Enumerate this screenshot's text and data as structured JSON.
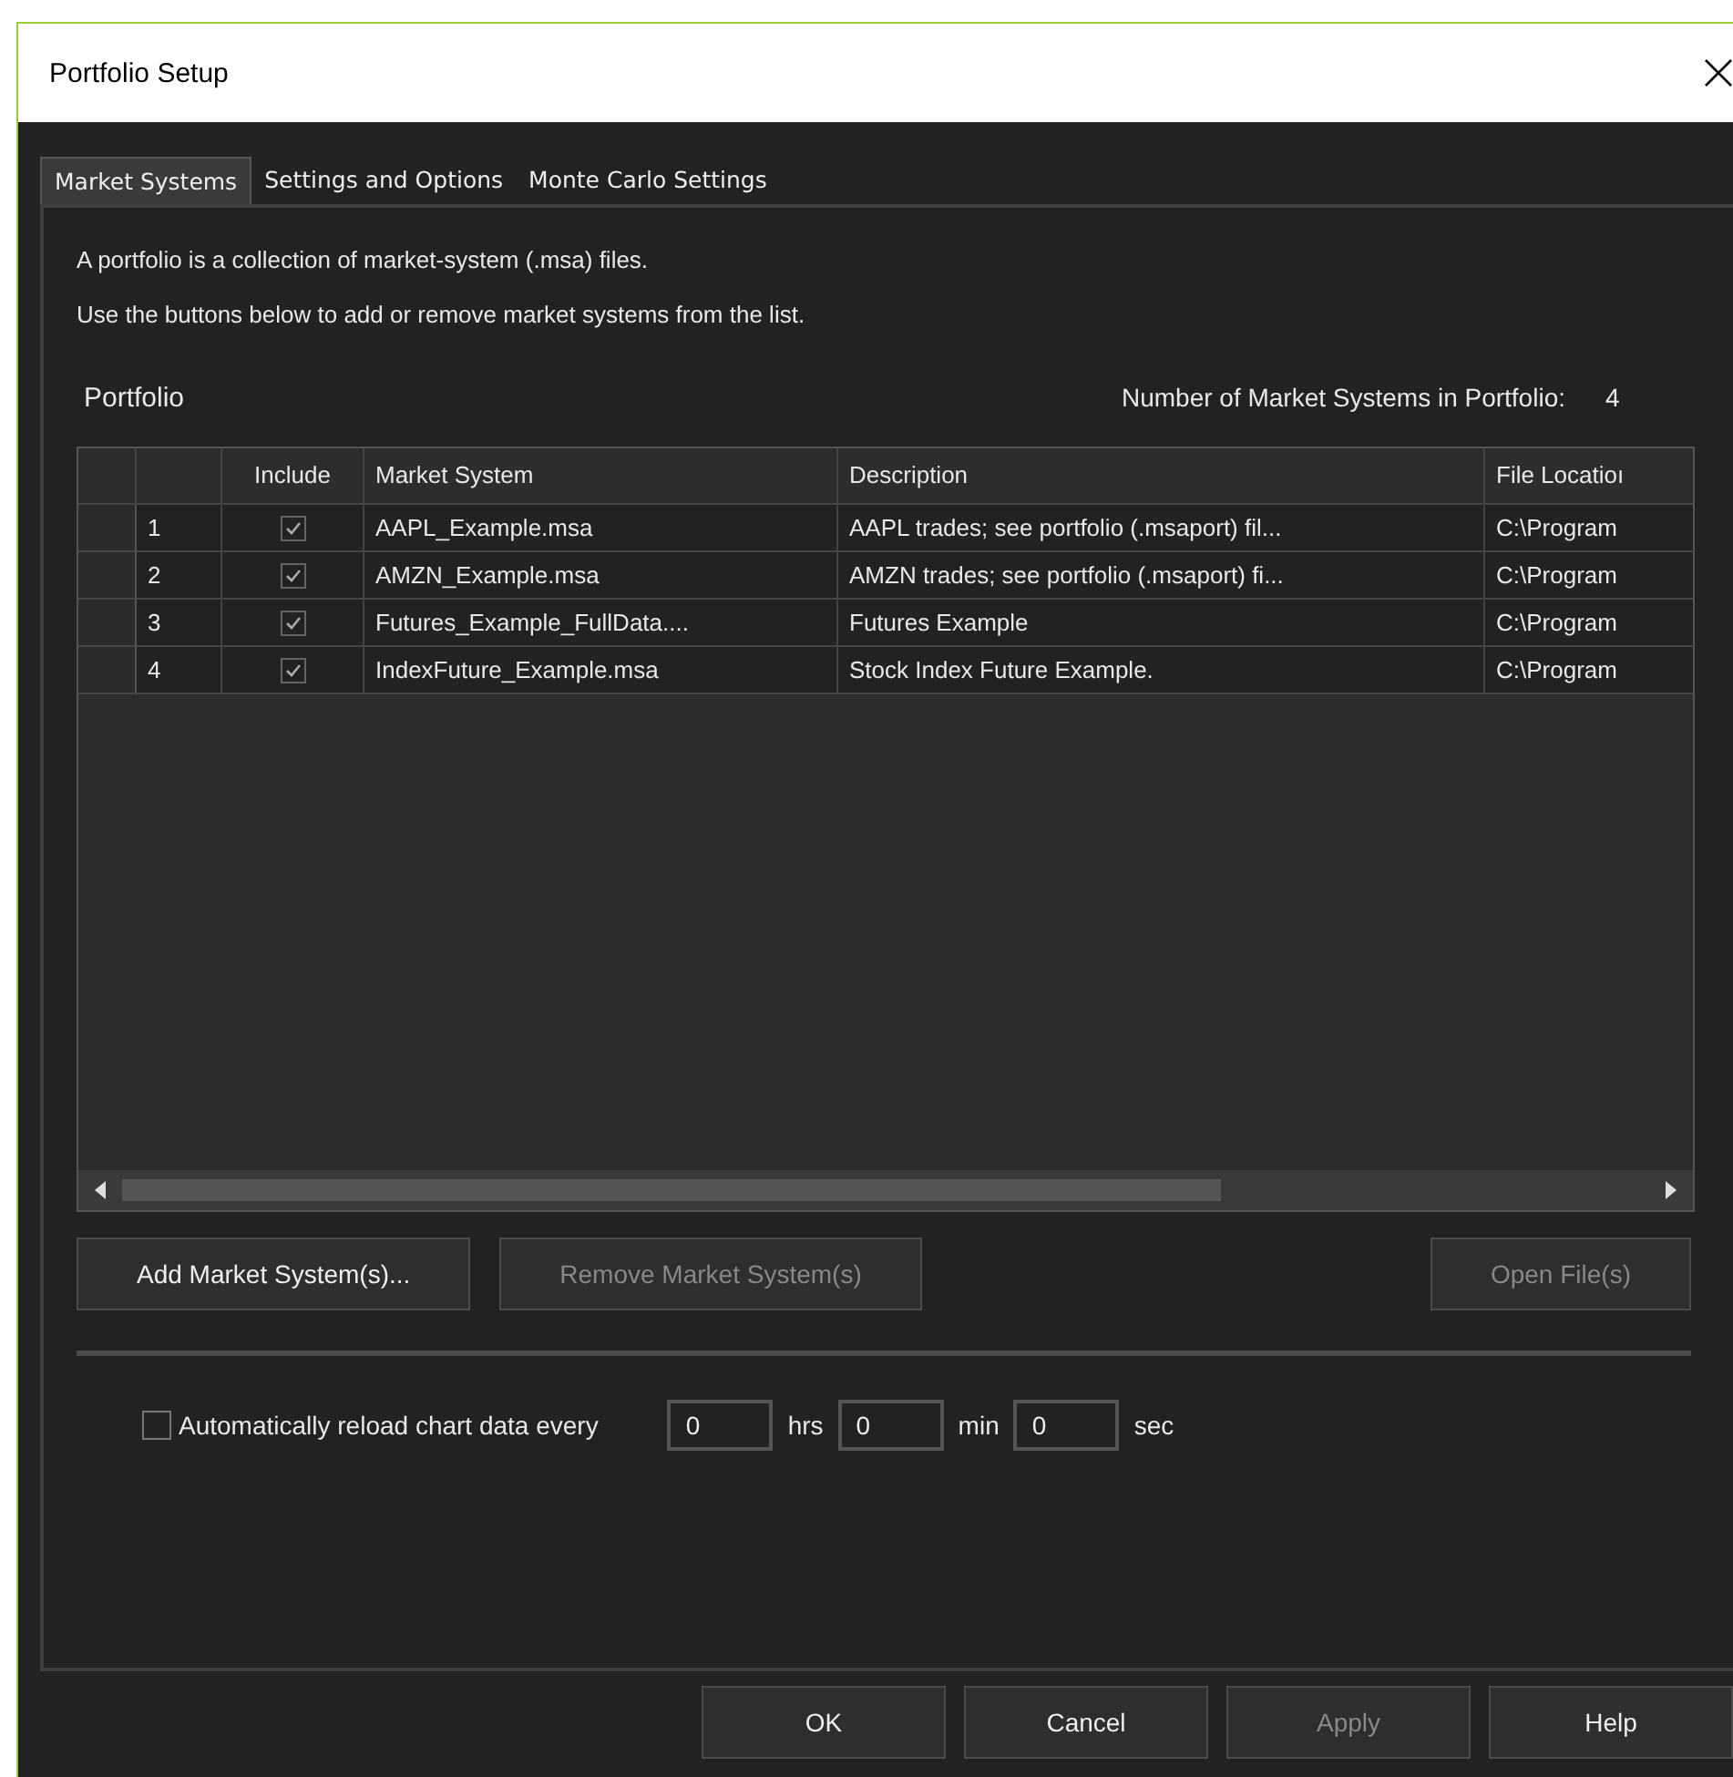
{
  "window": {
    "title": "Portfolio Setup"
  },
  "tabs": [
    {
      "label": "Market Systems",
      "selected": true
    },
    {
      "label": "Settings and Options",
      "selected": false
    },
    {
      "label": "Monte Carlo Settings",
      "selected": false
    }
  ],
  "intro": [
    "A portfolio is a collection of market-system (.msa) files.",
    "Use the buttons below to add or remove market systems from the list."
  ],
  "portfolio_label": "Portfolio",
  "count_label": "Number of Market Systems in Portfolio:",
  "count": "4",
  "table": {
    "columns": [
      "Include",
      "Market System",
      "Description",
      "File Locatioı"
    ],
    "rows": [
      {
        "number": "1",
        "include": true,
        "market_system": "AAPL_Example.msa",
        "description": "AAPL trades; see portfolio (.msaport) fil...",
        "file_location": "C:\\Program"
      },
      {
        "number": "2",
        "include": true,
        "market_system": "AMZN_Example.msa",
        "description": "AMZN trades; see portfolio (.msaport) fi...",
        "file_location": "C:\\Program"
      },
      {
        "number": "3",
        "include": true,
        "market_system": "Futures_Example_FullData....",
        "description": "Futures Example",
        "file_location": "C:\\Program"
      },
      {
        "number": "4",
        "include": true,
        "market_system": "IndexFuture_Example.msa",
        "description": "Stock Index Future Example.",
        "file_location": "C:\\Program"
      }
    ]
  },
  "list_buttons": [
    {
      "label": "Add Market System(s)...",
      "disabled": false
    },
    {
      "label": "Remove Market System(s)",
      "disabled": true
    },
    {
      "label": "Open File(s)",
      "disabled": true
    }
  ],
  "reload": {
    "label": "Automatically reload chart data every",
    "checked": false,
    "fields": [
      {
        "value": "0",
        "unit": "hrs"
      },
      {
        "value": "0",
        "unit": "min"
      },
      {
        "value": "0",
        "unit": "sec"
      }
    ]
  },
  "dialog_buttons": [
    {
      "label": "OK",
      "disabled": false
    },
    {
      "label": "Cancel",
      "disabled": false
    },
    {
      "label": "Apply",
      "disabled": true
    },
    {
      "label": "Help",
      "disabled": false
    }
  ]
}
